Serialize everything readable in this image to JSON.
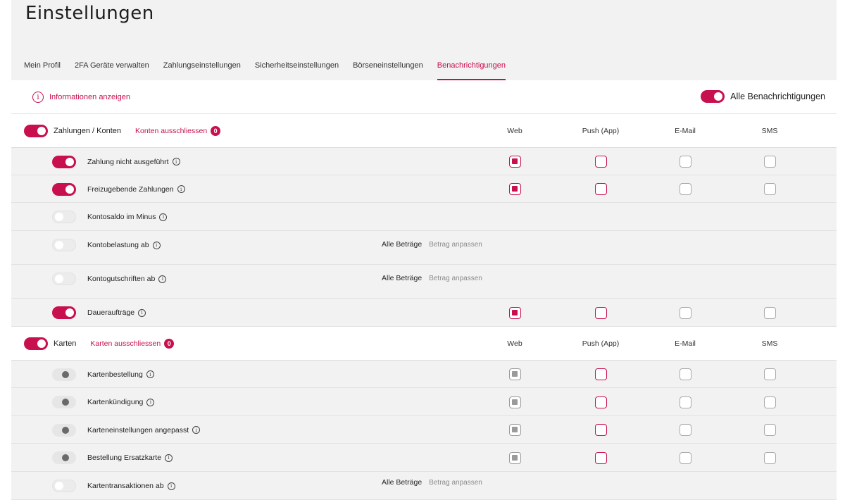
{
  "page": {
    "title": "Einstellungen"
  },
  "tabs": [
    {
      "label": "Mein Profil"
    },
    {
      "label": "2FA Geräte verwalten"
    },
    {
      "label": "Zahlungseinstellungen"
    },
    {
      "label": "Sicherheitseinstellungen"
    },
    {
      "label": "Börseneinstellungen"
    },
    {
      "label": "Benachrichtigungen",
      "active": true
    }
  ],
  "info": {
    "label": "Informationen anzeigen",
    "icon": "info-circle-icon"
  },
  "all_notifications": {
    "label": "Alle Benachrichtigungen",
    "on": true
  },
  "channels": [
    "Web",
    "Push (App)",
    "E-Mail",
    "SMS"
  ],
  "colors": {
    "accent": "#c8104e",
    "background_header": "#f2f2f2",
    "disabled": "#9a9a9a"
  },
  "sections": [
    {
      "title": "Zahlungen / Konten",
      "on": true,
      "exclude_label": "Konten ausschliessen",
      "exclude_count": "0",
      "rows": [
        {
          "label": "Zahlung nicht ausgeführt",
          "toggle": "on",
          "channels": [
            "checked",
            "unchecked",
            "unchecked",
            "unchecked"
          ]
        },
        {
          "label": "Freizugebende Zahlungen",
          "toggle": "on",
          "channels": [
            "checked",
            "unchecked",
            "unchecked",
            "unchecked"
          ]
        },
        {
          "label": "Kontosaldo im Minus",
          "toggle": "off",
          "channels": []
        },
        {
          "label": "Kontobelastung ab",
          "toggle": "off",
          "amount_all": "Alle Beträge",
          "amount_adjust": "Betrag anpassen",
          "channels": []
        },
        {
          "label": "Kontogutschriften ab",
          "toggle": "off",
          "amount_all": "Alle Beträge",
          "amount_adjust": "Betrag anpassen",
          "channels": []
        },
        {
          "label": "Daueraufträge",
          "toggle": "on",
          "channels": [
            "checked",
            "unchecked",
            "unchecked",
            "unchecked"
          ]
        }
      ]
    },
    {
      "title": "Karten",
      "on": true,
      "exclude_label": "Karten ausschliessen",
      "exclude_count": "0",
      "rows": [
        {
          "label": "Kartenbestellung",
          "toggle": "disabled",
          "channels": [
            "disabled-checked",
            "unchecked",
            "unchecked",
            "unchecked"
          ]
        },
        {
          "label": "Kartenkündigung",
          "toggle": "disabled",
          "channels": [
            "disabled-checked",
            "unchecked",
            "unchecked",
            "unchecked"
          ]
        },
        {
          "label": "Karteneinstellungen angepasst",
          "toggle": "disabled",
          "channels": [
            "disabled-checked",
            "unchecked",
            "unchecked",
            "unchecked"
          ]
        },
        {
          "label": "Bestellung Ersatzkarte",
          "toggle": "disabled",
          "channels": [
            "disabled-checked",
            "unchecked",
            "unchecked",
            "unchecked"
          ]
        },
        {
          "label": "Kartentransaktionen ab",
          "toggle": "off",
          "amount_all": "Alle Beträge",
          "amount_adjust": "Betrag anpassen",
          "channels": []
        }
      ]
    }
  ]
}
